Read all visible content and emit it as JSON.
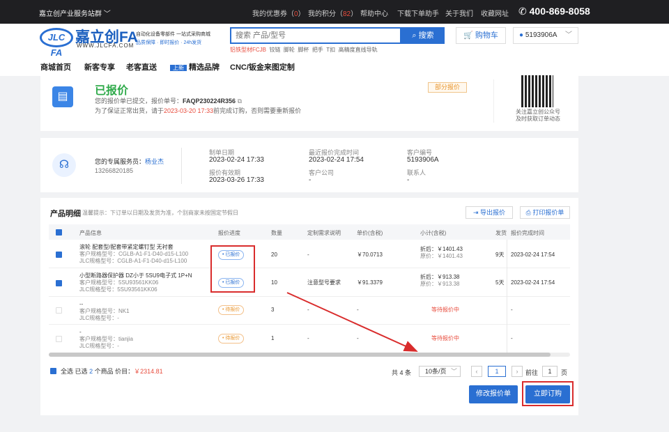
{
  "topbar": {
    "site": "嘉立创产业服务站群 ﹀",
    "coupon_label": "我的优惠券（",
    "coupon_count": "0",
    "coupon_close": "）",
    "points_label": "我的积分（",
    "points_count": "82",
    "points_close": "）",
    "help": "帮助中心",
    "download": "下载下单助手",
    "about": "关于我们",
    "favorite": "收藏网址",
    "phone": "400-869-8058"
  },
  "header": {
    "logo_mark": "JLC FA",
    "logo_cn": "嘉立创FA",
    "logo_url": "WWW.JLCFA.COM",
    "slogan1": "自动化设备零部件 一站式采购商城",
    "slogan2": "品质保障 · 即时报价 · 24h发货",
    "search_placeholder": "搜索 产品/型号",
    "search_button": "搜索",
    "hot_words": [
      "铝铁型材FCJB",
      "铰链",
      "脚轮",
      "脚杯",
      "把手",
      "T扣",
      "高精度直线导轨"
    ],
    "cart_button": "购物车",
    "user_button": "5193906A"
  },
  "nav": {
    "items": [
      "商城首页",
      "新客专享",
      "老客直送",
      "精选品牌",
      "CNC/钣金来图定制"
    ],
    "new_badge": "上新"
  },
  "status": {
    "title": "已报价",
    "line1_prefix": "您的报价单已提交，报价单号：",
    "order_no": "FAQP230224R356",
    "line2_prefix": "为了保证正常出货，请于",
    "deadline": "2023-03-20 17:33",
    "line2_suffix": "前完成订购，否则需要重新报价",
    "tag": "部分报价",
    "qr_text1": "关注嘉立创公众号",
    "qr_text2": "及时获取订单动态"
  },
  "service": {
    "name_label": "您的专属服务员：",
    "name": "杨业杰",
    "phone": "13266820185",
    "fields": [
      {
        "label": "制单日期",
        "value": "2023-02-24 17:33"
      },
      {
        "label": "最近报价完成时间",
        "value": "2023-02-24 17:54"
      },
      {
        "label": "客户编号",
        "value": "5193906A"
      },
      {
        "label": "报价有效期",
        "value": "2023-03-26 17:33"
      },
      {
        "label": "客户公司",
        "value": "-"
      },
      {
        "label": "联系人",
        "value": "-"
      }
    ]
  },
  "products": {
    "title": "产品明细",
    "tip": "温馨提示：下订单以日期及发货为准，个别商家未按国定节假日",
    "export_button": "导出报价",
    "print_button": "打印报价单",
    "headers": [
      "产品信息",
      "报价进度",
      "数量",
      "定制需求说明",
      "单价(含税)",
      "小计(含税)",
      "发货",
      "报价完成时间"
    ],
    "rows": [
      {
        "checked": true,
        "name": "滚轮 配套型/配套带紧定螺钉型 无衬套",
        "cust_model": "客户规格型号：CGLB-A1-F1-D40-d15-L100",
        "jlc_model": "JLC规格型号：CGLB-A1-F1-D40-d15-L100",
        "status": "已报价",
        "qty": "20",
        "req": "-",
        "price": "￥70.0713",
        "sub1": "折后：￥1401.43",
        "sub2": "原价：￥1401.43",
        "ship": "9天",
        "done": "2023-02-24 17:54"
      },
      {
        "checked": true,
        "name": "小型断路器保护器 DZ小于 5SU9电子式 1P+N",
        "cust_model": "客户规格型号：5SU93561KK06",
        "jlc_model": "JLC规格型号：5SU93561KK06",
        "status": "已报价",
        "qty": "10",
        "req": "注意型号要求",
        "price": "￥91.3379",
        "sub1": "折后：￥913.38",
        "sub2": "原价：￥913.38",
        "ship": "5天",
        "done": "2023-02-24 17:54"
      },
      {
        "checked": false,
        "name": "--",
        "cust_model": "客户规格型号：NK1",
        "jlc_model": "JLC规格型号：-",
        "status": "待报价",
        "qty": "3",
        "req": "-",
        "price": "-",
        "sub1": "等待报价中",
        "sub2": "",
        "ship": "",
        "done": "-"
      },
      {
        "checked": false,
        "name": "-",
        "cust_model": "客户规格型号：tianjia",
        "jlc_model": "JLC规格型号：-",
        "status": "待报价",
        "qty": "1",
        "req": "-",
        "price": "-",
        "sub1": "等待报价中",
        "sub2": "",
        "ship": "",
        "done": "-"
      }
    ]
  },
  "footer": {
    "select_all": "全选",
    "selected_prefix": "已选",
    "selected_count": "2",
    "selected_suffix": "个商品 价目：",
    "total": "￥2314.81",
    "total_items": "共 4 条",
    "page_size": "10条/页",
    "page_current": "1",
    "goto_label": "前往",
    "goto_value": "1",
    "page_unit": "页",
    "modify_button": "修改报价单",
    "order_button": "立即订购"
  },
  "colors": {
    "accent": "#2a6fd2",
    "success": "#2faa4a",
    "danger": "#e84c3d",
    "annotation": "#d92c2c"
  }
}
